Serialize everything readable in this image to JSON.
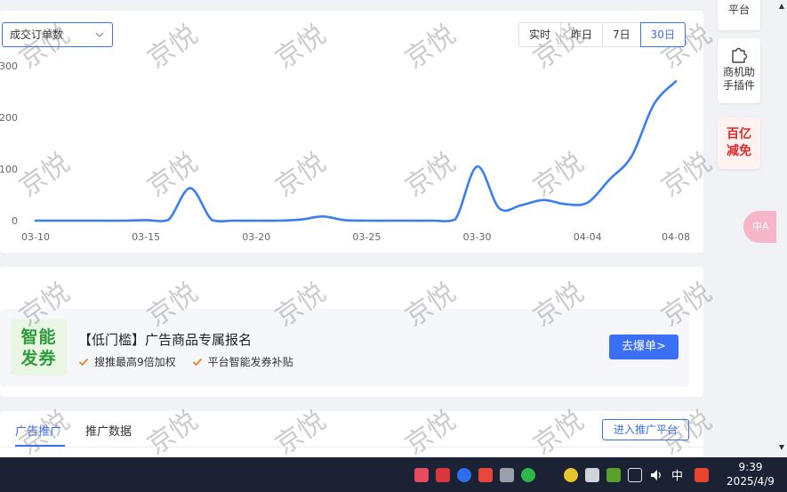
{
  "metric_select": {
    "value": "成交订单数"
  },
  "range_options": [
    {
      "label": "实时",
      "active": false
    },
    {
      "label": "昨日",
      "active": false
    },
    {
      "label": "7日",
      "active": false
    },
    {
      "label": "30日",
      "active": true
    }
  ],
  "chart_data": {
    "type": "line",
    "x_tick_labels": [
      "03-10",
      "03-15",
      "03-20",
      "03-25",
      "03-30",
      "04-04",
      "04-08"
    ],
    "y_tick_labels": [
      "0",
      "100",
      "200",
      "300"
    ],
    "ylim": [
      0,
      300
    ],
    "x": [
      "03-10",
      "03-11",
      "03-12",
      "03-13",
      "03-14",
      "03-15",
      "03-16",
      "03-17",
      "03-18",
      "03-19",
      "03-20",
      "03-21",
      "03-22",
      "03-23",
      "03-24",
      "03-25",
      "03-26",
      "03-27",
      "03-28",
      "03-29",
      "03-30",
      "03-31",
      "04-01",
      "04-02",
      "04-03",
      "04-04",
      "04-05",
      "04-06",
      "04-07",
      "04-08"
    ],
    "series": [
      {
        "values": [
          0,
          0,
          0,
          0,
          0,
          1,
          1,
          63,
          1,
          0,
          0,
          0,
          2,
          8,
          1,
          0,
          0,
          0,
          0,
          2,
          105,
          24,
          30,
          40,
          32,
          35,
          80,
          125,
          225,
          270
        ]
      }
    ],
    "color": "#3b7df2",
    "grid": false
  },
  "promo": {
    "badge_line1": "智能",
    "badge_line2": "发券",
    "title": "【低门槛】广告商品专属报名",
    "bullet1": "搜推最高9倍加权",
    "bullet2": "平台智能发券补贴",
    "button": "去爆单>"
  },
  "tabs": {
    "ad_promotion": "广告推广",
    "promotion_data": "推广数据",
    "enter_platform": "进入推广平台"
  },
  "side_tools": {
    "platform": "平台",
    "helper_line1": "商机助",
    "helper_line2": "手插件",
    "reduce_line1": "百亿",
    "reduce_line2": "减免"
  },
  "float_tab": "中A",
  "taskbar": {
    "ime": "中",
    "time": "9:39",
    "date": "2025/4/9"
  },
  "watermark": "京悦",
  "colors": {
    "accent": "#3b6ff5",
    "line": "#3b7df2",
    "badge_green": "#2e9b3c",
    "reduce_red": "#e02a2a"
  }
}
